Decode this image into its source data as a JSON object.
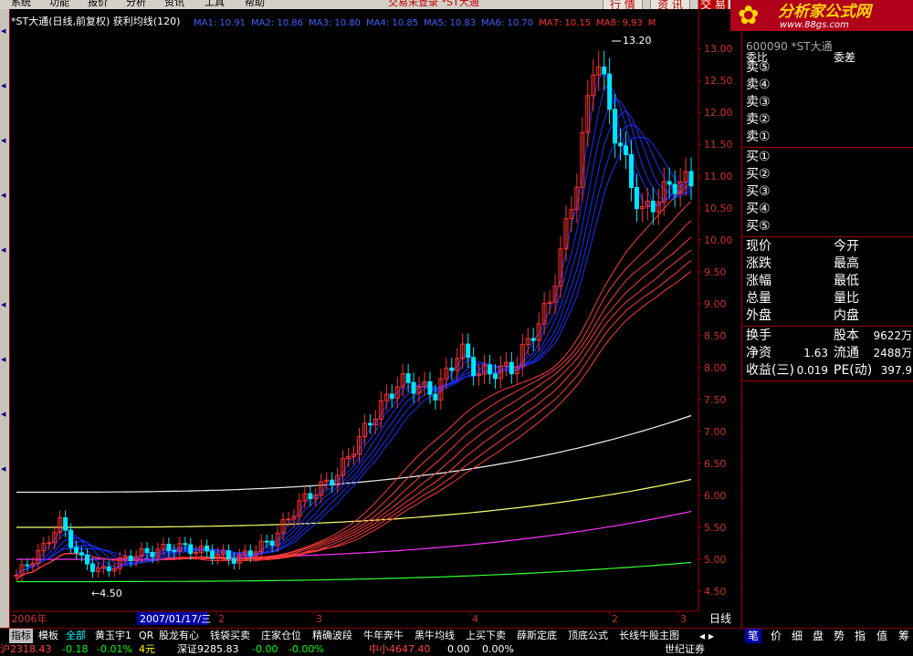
{
  "menu": {
    "items": [
      "系统",
      "功能",
      "报价",
      "分析",
      "资讯",
      "工具",
      "帮助"
    ],
    "status": "交易未登录  *ST大通",
    "top_buttons": [
      "行 情",
      "资 讯",
      "交 易"
    ],
    "win_controls": [
      "_",
      "□",
      "×"
    ]
  },
  "chart": {
    "title": "*ST大通(日线,前复权) 获利均线(120)",
    "ma_labels": [
      {
        "text": "MA1: 10.91",
        "color": "#4060ff"
      },
      {
        "text": "MA2: 10.86",
        "color": "#4060ff"
      },
      {
        "text": "MA3: 10.80",
        "color": "#4060ff"
      },
      {
        "text": "MA4: 10.85",
        "color": "#4060ff"
      },
      {
        "text": "MA5: 10.83",
        "color": "#4060ff"
      },
      {
        "text": "MA6: 10.70",
        "color": "#4060ff"
      },
      {
        "text": "MA7: 10.15",
        "color": "#ff3030"
      },
      {
        "text": "MA8: 9.93",
        "color": "#ff3030"
      },
      {
        "text": "M",
        "color": "#ff3030"
      }
    ],
    "high_label": "13.20",
    "low_label": "4.50",
    "date_label": "2007/01/17/三",
    "axis_x": [
      {
        "label": "2006年",
        "pos": 0.5
      },
      {
        "label": "2",
        "pos": 227
      },
      {
        "label": "3",
        "pos": 334
      },
      {
        "label": "4",
        "pos": 505
      },
      {
        "label": "2",
        "pos": 658
      },
      {
        "label": "3",
        "pos": 733
      }
    ],
    "period_label": "日线",
    "ylim": [
      4.4,
      13.3
    ],
    "y_ticks": [
      "13.00",
      "12.50",
      "12.00",
      "11.50",
      "11.00",
      "10.50",
      "10.00",
      "9.50",
      "9.00",
      "8.50",
      "8.00",
      "7.50",
      "7.00",
      "6.50",
      "6.00",
      "5.50",
      "5.00",
      "4.50"
    ]
  },
  "logo": {
    "title": "分析家公式网",
    "url": "www.88gs.com",
    "code": "600090  *ST大通"
  },
  "panel": {
    "header": [
      "委比",
      "委差"
    ],
    "sell": [
      "卖⑤",
      "卖④",
      "卖③",
      "卖②",
      "卖①"
    ],
    "buy": [
      "买①",
      "买②",
      "买③",
      "买④",
      "买⑤"
    ],
    "left_labels": [
      "现价",
      "涨跌",
      "涨幅",
      "总量",
      "外盘"
    ],
    "right_labels": [
      "今开",
      "最高",
      "最低",
      "量比",
      "内盘"
    ],
    "stats": [
      {
        "l": "换手",
        "lv": "",
        "r": "股本",
        "rv": "9622万"
      },
      {
        "l": "净资",
        "lv": "1.63",
        "r": "流通",
        "rv": "2488万"
      },
      {
        "l": "收益(三)",
        "lv": "0.019",
        "r": "PE(动)",
        "rv": "397.9"
      }
    ]
  },
  "tabs": {
    "items": [
      "指标",
      "模板",
      "全部",
      "黄玉宇1",
      "QR",
      "股龙有心",
      "钱袋买卖",
      "庄家仓位",
      "精确波段",
      "牛年奔牛",
      "黑牛均线",
      "上买下卖",
      "薛斯定底",
      "顶底公式",
      "长线牛股主图"
    ],
    "right": [
      "笔",
      "价",
      "细",
      "盘",
      "势",
      "指",
      "值",
      "筹"
    ]
  },
  "bottom": [
    {
      "t": "沪2318.43",
      "c": "#ff4040"
    },
    {
      "t": "-0.18",
      "c": "#00ff00"
    },
    {
      "t": "-0.01%",
      "c": "#00ff00"
    },
    {
      "t": "4元",
      "c": "#ffff00"
    },
    {
      "t": "深证9285.83",
      "c": "#ffffff"
    },
    {
      "t": "-0.00",
      "c": "#00ff00"
    },
    {
      "t": "-0.00%",
      "c": "#00ff00"
    },
    {
      "t": "中小4647.40",
      "c": "#ff4040"
    },
    {
      "t": "0.00",
      "c": "#ffffff"
    },
    {
      "t": "0.00%",
      "c": "#ffffff"
    },
    {
      "t": "世纪证券",
      "c": "#ffffff"
    }
  ],
  "colors": {
    "up": "#ff3030",
    "down": "#00e5ff",
    "blue_ma": "#1830ff",
    "red_ma": "#ff3a3a",
    "white": "#f0f0f0",
    "yellow": "#ffff70",
    "magenta": "#ff30ff",
    "green": "#30ff30",
    "axis": "#a00000"
  }
}
